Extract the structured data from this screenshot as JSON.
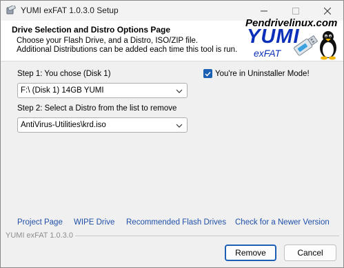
{
  "window": {
    "title": "YUMI exFAT 1.0.3.0 Setup"
  },
  "header": {
    "title": "Drive Selection and Distro Options Page",
    "description": "Choose your Flash Drive, and a Distro, ISO/ZIP file.\nAdditional Distributions can be added each time this tool is run.",
    "brand_site": "Pendrivelinux.com",
    "brand_name": "YUMI",
    "brand_sub": "exFAT"
  },
  "step1": {
    "label": "Step 1: You chose (Disk 1)",
    "selected": "F:\\ (Disk 1) 14GB YUMI"
  },
  "uninstaller_mode": {
    "label": "You're in Uninstaller Mode!",
    "checked": true
  },
  "step2": {
    "label": "Step 2: Select a Distro from the list to remove",
    "selected": "AntiVirus-Utilities\\krd.iso"
  },
  "links": {
    "project_page": "Project Page",
    "wipe_drive": "WIPE Drive",
    "recommended": "Recommended Flash Drives",
    "check_newer": "Check for a Newer Version"
  },
  "footer": {
    "version": "YUMI exFAT 1.0.3.0"
  },
  "buttons": {
    "remove": "Remove",
    "cancel": "Cancel"
  },
  "colors": {
    "accent": "#1a5fb4",
    "link": "#1f4fa8",
    "brand": "#0a2fb8"
  },
  "icons": {
    "app": "usb-installer-icon",
    "minimize": "minimize-icon",
    "maximize": "maximize-icon",
    "close": "close-icon",
    "dropdown": "chevron-down-icon",
    "check": "checkmark-icon"
  }
}
